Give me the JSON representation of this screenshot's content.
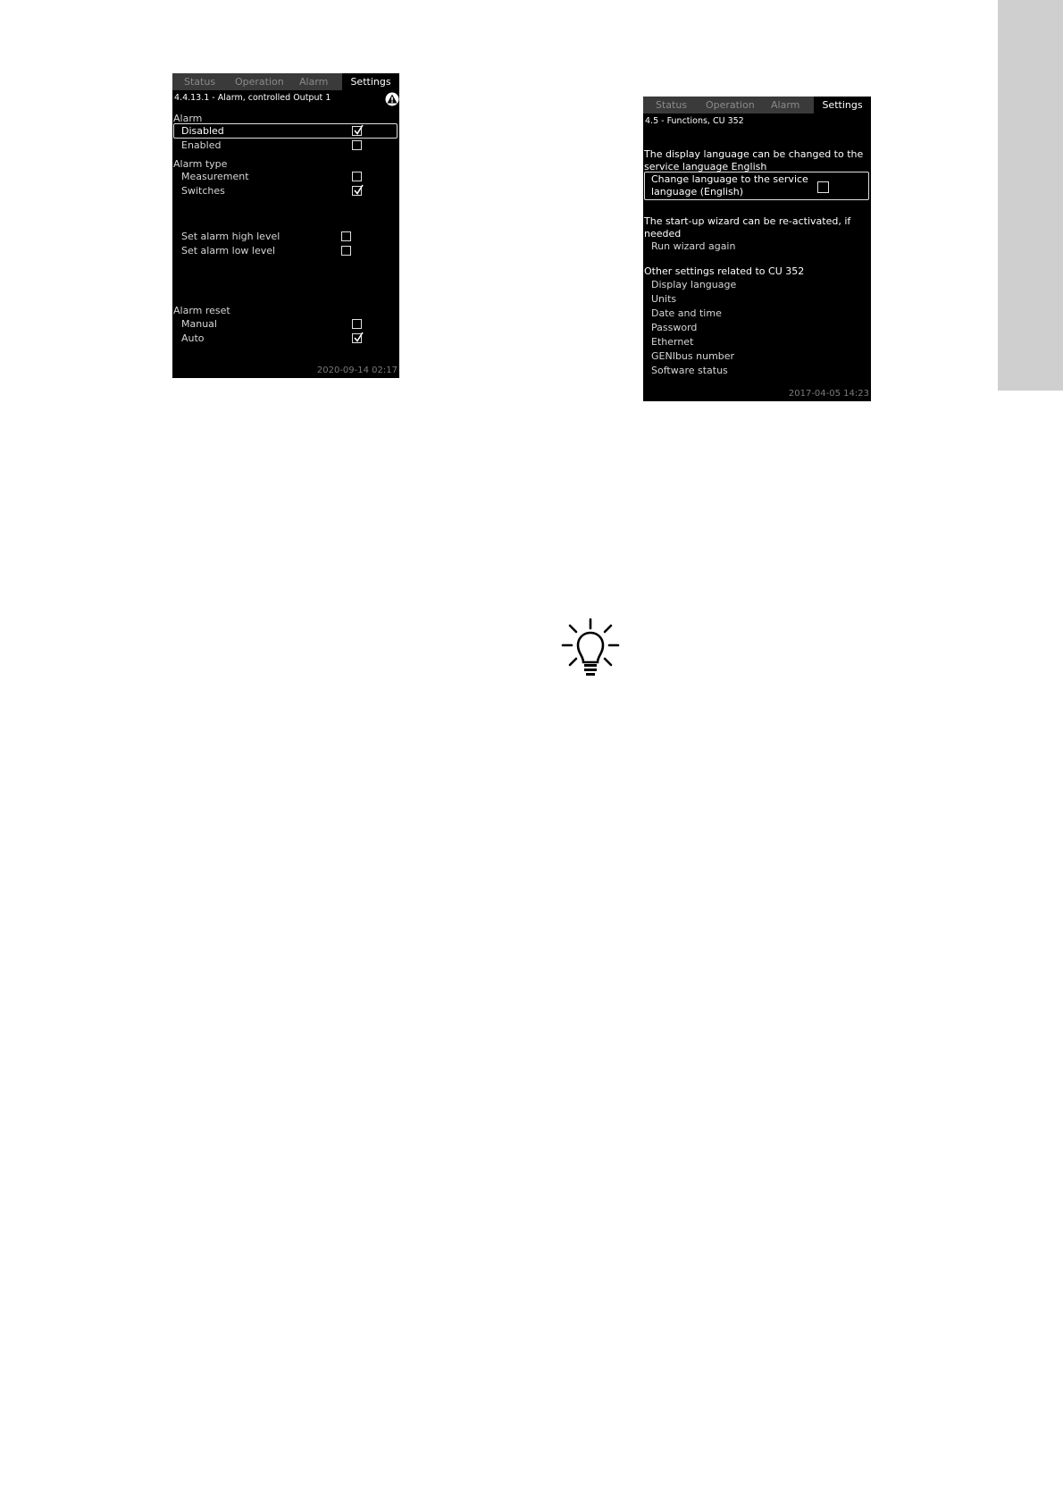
{
  "tabs": {
    "status": "Status",
    "operation": "Operation",
    "alarm": "Alarm",
    "settings": "Settings"
  },
  "screen1": {
    "path": "4.4.13.1 - Alarm, controlled Output 1",
    "alarm_header": "Alarm",
    "disabled": "Disabled",
    "enabled": "Enabled",
    "alarm_type_header": "Alarm type",
    "measurement": "Measurement",
    "switches": "Switches",
    "set_high": "Set alarm high level",
    "set_low": "Set alarm low level",
    "alarm_reset_header": "Alarm reset",
    "manual": "Manual",
    "auto": "Auto",
    "timestamp": "2020-09-14  02:17",
    "checked": {
      "disabled": true,
      "enabled": false,
      "measurement": false,
      "switches": true,
      "set_high": false,
      "set_low": false,
      "manual": false,
      "auto": true
    }
  },
  "screen2": {
    "path": "4.5 - Functions, CU 352",
    "text1": "The display language can be changed to the service language English",
    "change_language": "Change language to the service language (English)",
    "text2": "The start-up wizard can be re-activated, if needed",
    "run_wizard": "Run wizard again",
    "text3": "Other settings related to CU 352",
    "links": [
      "Display language",
      "Units",
      "Date and time",
      "Password",
      "Ethernet",
      "GENIbus number",
      "Software status"
    ],
    "timestamp": "2017-04-05  14:23",
    "checked": {
      "change_language": false
    }
  },
  "icons": [
    "warning-icon",
    "checkbox-icon",
    "lightbulb-icon"
  ]
}
